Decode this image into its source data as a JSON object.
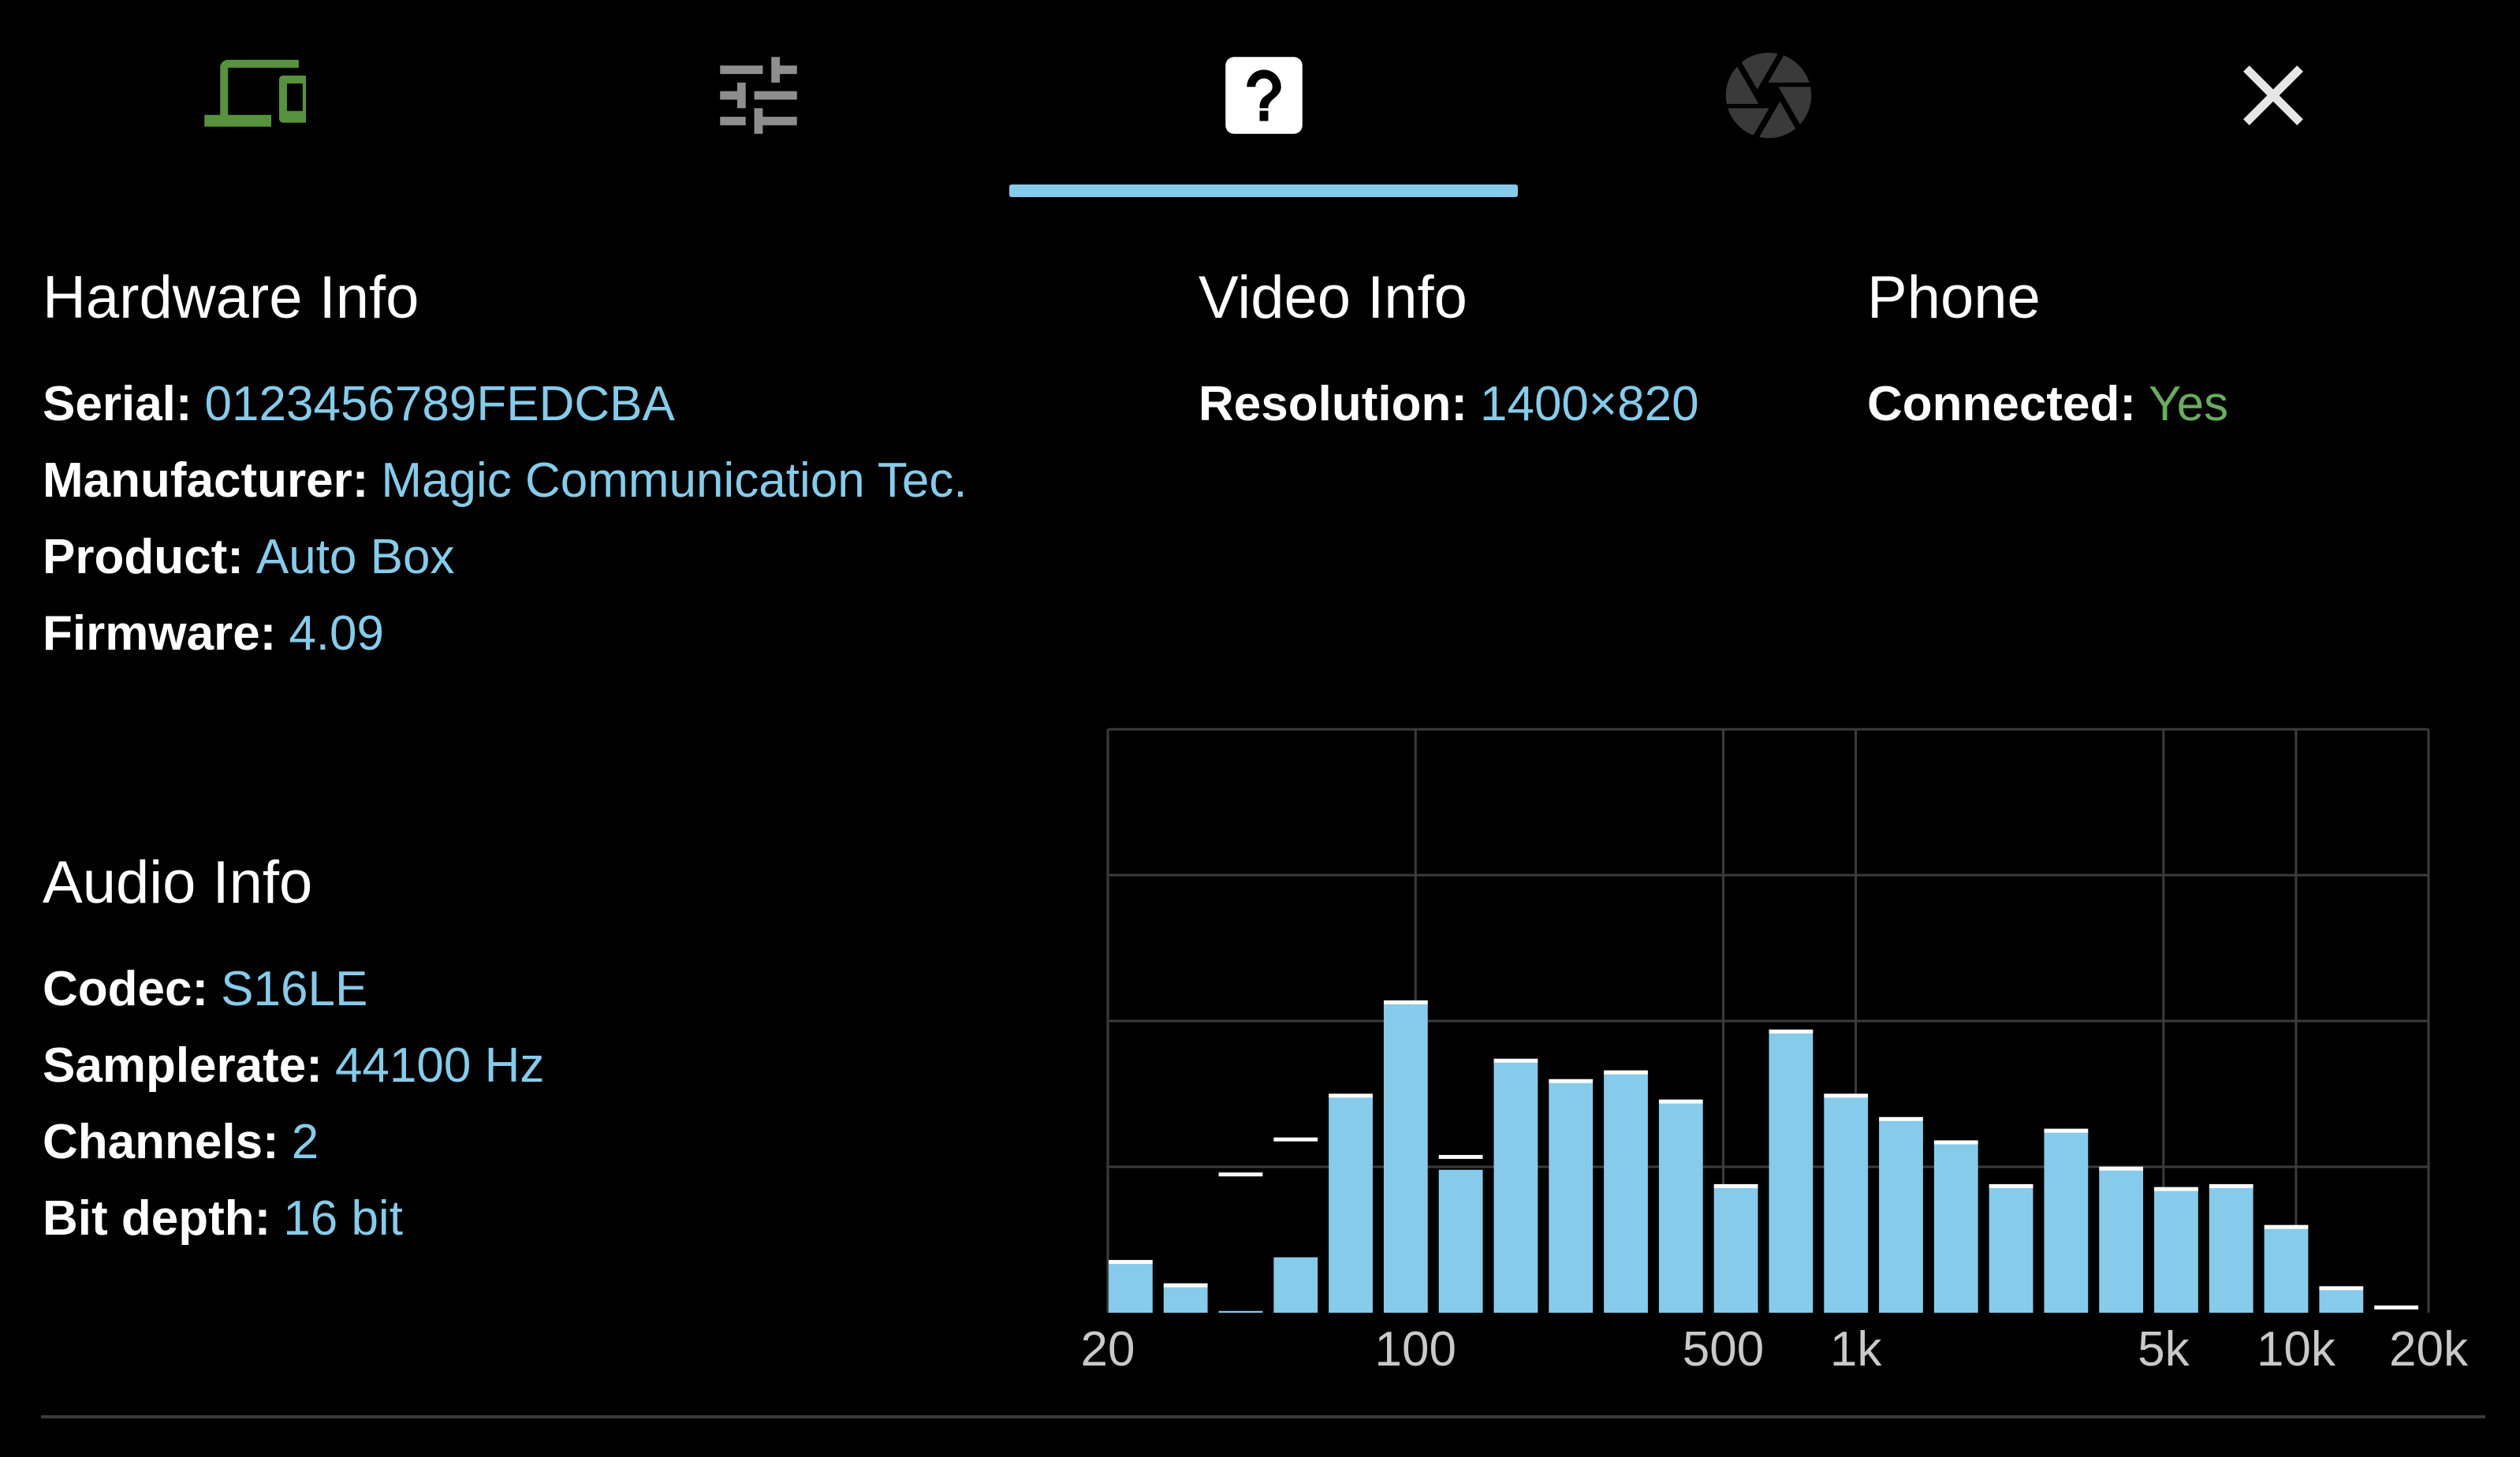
{
  "colors": {
    "accent": "#87cbea",
    "connected": "#69ad5e",
    "device_icon": "#58923f",
    "inactive_icon": "#8e8e8e",
    "close_icon": "#e6e6e6",
    "bar_cap": "#ffffff",
    "grid": "#3c3c3c",
    "tick_text": "#c9c9c9"
  },
  "tabs": [
    {
      "id": "devices",
      "icon": "devices-icon",
      "active": false
    },
    {
      "id": "settings",
      "icon": "sliders-icon",
      "active": false
    },
    {
      "id": "info",
      "icon": "help-box-icon",
      "active": true
    },
    {
      "id": "camera",
      "icon": "camera-iris-icon",
      "active": false
    },
    {
      "id": "close",
      "icon": "close-icon",
      "active": false
    }
  ],
  "hardware": {
    "title": "Hardware Info",
    "serial_label": "Serial:",
    "serial": "0123456789FEDCBA",
    "manufacturer_label": "Manufacturer:",
    "manufacturer": "Magic Communication Tec.",
    "product_label": "Product:",
    "product": "Auto Box",
    "firmware_label": "Firmware:",
    "firmware": "4.09"
  },
  "video": {
    "title": "Video Info",
    "resolution_label": "Resolution:",
    "resolution": "1400×820"
  },
  "phone": {
    "title": "Phone",
    "connected_label": "Connected:",
    "connected": "Yes"
  },
  "audio": {
    "title": "Audio Info",
    "codec_label": "Codec:",
    "codec": "S16LE",
    "samplerate_label": "Samplerate:",
    "samplerate": "44100 Hz",
    "channels_label": "Channels:",
    "channels": "2",
    "bitdepth_label": "Bit depth:",
    "bitdepth": "16 bit"
  },
  "chart_data": {
    "type": "bar",
    "x_scale": "log",
    "xlim": [
      20,
      20000
    ],
    "ylim": [
      0,
      100
    ],
    "xticks": [
      {
        "value": 20,
        "label": "20"
      },
      {
        "value": 100,
        "label": "100"
      },
      {
        "value": 500,
        "label": "500"
      },
      {
        "value": 1000,
        "label": "1k"
      },
      {
        "value": 5000,
        "label": "5k"
      },
      {
        "value": 10000,
        "label": "10k"
      },
      {
        "value": 20000,
        "label": "20k"
      }
    ],
    "y_gridlines": [
      25,
      50,
      75,
      100
    ],
    "grid": true,
    "bands": [
      {
        "level": 8.5,
        "peak": 8.5
      },
      {
        "level": 4.5,
        "peak": 4.5
      },
      {
        "level": 0.3,
        "peak": 23.5
      },
      {
        "level": 9.5,
        "peak": 29.5
      },
      {
        "level": 37,
        "peak": 37
      },
      {
        "level": 53,
        "peak": 53
      },
      {
        "level": 24.5,
        "peak": 26.5
      },
      {
        "level": 43,
        "peak": 43
      },
      {
        "level": 39.5,
        "peak": 39.5
      },
      {
        "level": 41,
        "peak": 41
      },
      {
        "level": 36,
        "peak": 36
      },
      {
        "level": 21.5,
        "peak": 21.5
      },
      {
        "level": 48,
        "peak": 48
      },
      {
        "level": 37,
        "peak": 37
      },
      {
        "level": 33,
        "peak": 33
      },
      {
        "level": 29,
        "peak": 29
      },
      {
        "level": 21.5,
        "peak": 21.5
      },
      {
        "level": 31,
        "peak": 31
      },
      {
        "level": 24.5,
        "peak": 24.5
      },
      {
        "level": 21,
        "peak": 21
      },
      {
        "level": 21.5,
        "peak": 21.5
      },
      {
        "level": 14.5,
        "peak": 14.5
      },
      {
        "level": 4,
        "peak": 4
      },
      {
        "level": 0,
        "peak": 0.7
      }
    ]
  }
}
